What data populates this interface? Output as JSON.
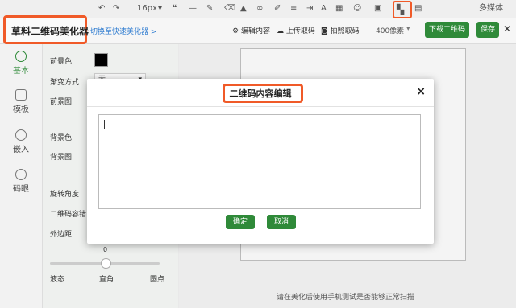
{
  "toolbar": {
    "font_size": "16px",
    "media": "多媒体"
  },
  "header": {
    "title": "草料二维码美化器",
    "switch_link": "切换至快速美化器 >",
    "edit_content": "编辑内容",
    "upload": "上传取码",
    "photo": "拍照取码",
    "size": "400像素",
    "download": "下载二维码",
    "save": "保存"
  },
  "sidebar": {
    "items": [
      {
        "label": "基本"
      },
      {
        "label": "模板"
      },
      {
        "label": "嵌入"
      },
      {
        "label": "码眼"
      }
    ]
  },
  "panel": {
    "fg_color": "前景色",
    "gradient": "渐变方式",
    "gradient_value": "无",
    "fg_image": "前景图",
    "bg_color": "背景色",
    "bg_image": "背景图",
    "rotate": "旋转角度",
    "error_level": "二维码容错",
    "margin": "外边距",
    "slider_value": "0",
    "slider_left": "液态",
    "slider_mid": "直角",
    "slider_right": "圆点"
  },
  "canvas": {
    "hint": "请在美化后使用手机测试是否能够正常扫描"
  },
  "modal": {
    "title": "二维码内容编辑",
    "close": "×",
    "textarea_value": "",
    "confirm": "确定",
    "cancel": "取消"
  }
}
